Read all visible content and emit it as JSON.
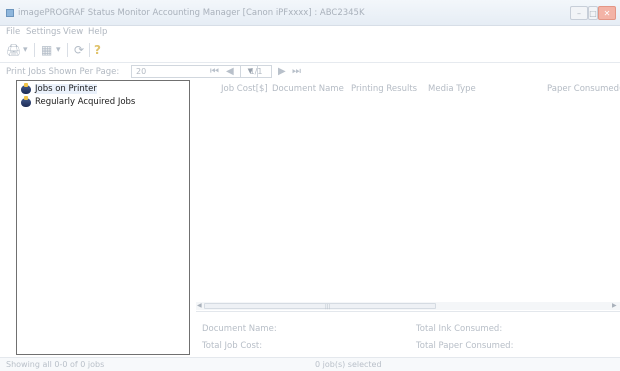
{
  "window": {
    "title": "imagePROGRAF Status Monitor Accounting Manager [Canon iPFxxxx] : ABC2345K",
    "minimize_glyph": "–",
    "maximize_glyph": "□",
    "close_glyph": "✕"
  },
  "menu": {
    "items": [
      {
        "label": "File"
      },
      {
        "label": "Settings"
      },
      {
        "label": "View"
      },
      {
        "label": "Help"
      }
    ]
  },
  "toolbar": {
    "tools": [
      {
        "icon": "printer-icon",
        "glyph": "🖨"
      },
      {
        "icon": "dropdown-arrow-icon",
        "glyph": "▾"
      },
      {
        "icon": "calendar-icon",
        "glyph": "▦"
      },
      {
        "icon": "dropdown-arrow-icon",
        "glyph": "▾"
      },
      {
        "icon": "refresh-icon",
        "glyph": "⟳"
      },
      {
        "icon": "help-icon",
        "glyph": "?"
      }
    ]
  },
  "pager": {
    "label": "Print Jobs Shown Per Page:",
    "per_page_value": "20",
    "page_indicator": "1/1",
    "first_glyph": "⏮",
    "prev_glyph": "◀",
    "next_glyph": "▶",
    "last_glyph": "⏭"
  },
  "tree": {
    "items": [
      {
        "label": "Jobs on Printer",
        "selected": true
      },
      {
        "label": "Regularly Acquired Jobs",
        "selected": false
      }
    ]
  },
  "grid": {
    "columns": [
      "Job Cost[$]",
      "Document Name",
      "Printing Results",
      "Media Type",
      "Paper Consumed(m"
    ],
    "rows": [],
    "scroll_left_glyph": "◀",
    "scroll_right_glyph": "▶",
    "grip_glyph": "|||"
  },
  "details": {
    "document_name_label": "Document Name:",
    "total_job_cost_label": "Total Job Cost:",
    "total_ink_label": "Total Ink Consumed:",
    "total_paper_label": "Total Paper Consumed:"
  },
  "status": {
    "left_text": "Showing all 0-0 of 0 jobs",
    "center_text": "0 job(s) selected"
  }
}
